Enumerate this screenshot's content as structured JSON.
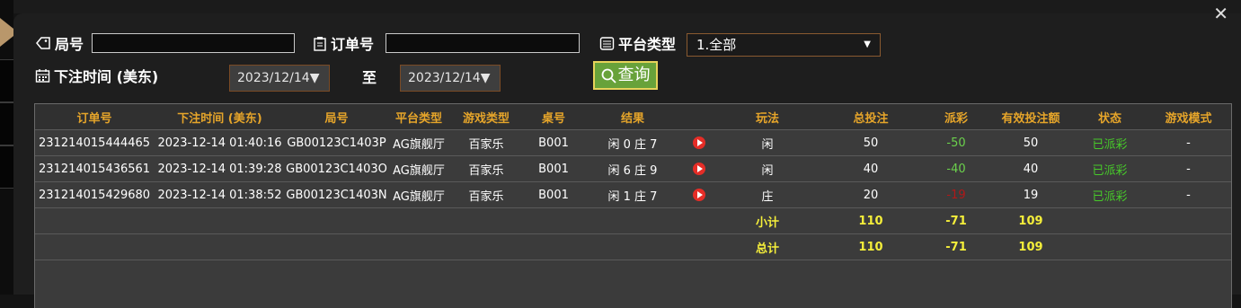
{
  "filters": {
    "round_label": "局号",
    "round_value": "",
    "order_label": "订单号",
    "order_value": "",
    "platform_label": "平台类型",
    "platform_selected": "1.全部",
    "bet_time_label": "下注时间 (美东)",
    "date_from": "2023/12/14",
    "to_label": "至",
    "date_to": "2023/12/14",
    "search_label": "查询"
  },
  "table": {
    "headers": [
      "订单号",
      "下注时间 (美东)",
      "局号",
      "平台类型",
      "游戏类型",
      "桌号",
      "结果",
      "",
      "玩法",
      "总投注",
      "派彩",
      "有效投注额",
      "状态",
      "游戏模式"
    ],
    "rows": [
      {
        "order": "231214015444465",
        "time": "2023-12-14 01:40:16",
        "round": "GB00123C1403P",
        "platform": "AG旗舰厅",
        "game": "百家乐",
        "table": "B001",
        "result": "闲 0 庄 7",
        "play": "闲",
        "bet": "50",
        "payout": "-50",
        "valid": "50",
        "status": "已派彩",
        "mode": "-"
      },
      {
        "order": "231214015436561",
        "time": "2023-12-14 01:39:28",
        "round": "GB00123C1403O",
        "platform": "AG旗舰厅",
        "game": "百家乐",
        "table": "B001",
        "result": "闲 6 庄 9",
        "play": "闲",
        "bet": "40",
        "payout": "-40",
        "valid": "40",
        "status": "已派彩",
        "mode": "-"
      },
      {
        "order": "231214015429680",
        "time": "2023-12-14 01:38:52",
        "round": "GB00123C1403N",
        "platform": "AG旗舰厅",
        "game": "百家乐",
        "table": "B001",
        "result": "闲 1 庄 7",
        "play": "庄",
        "bet": "20",
        "payout": "-19",
        "valid": "19",
        "status": "已派彩",
        "mode": "-"
      }
    ],
    "subtotal": {
      "label": "小计",
      "bet": "110",
      "payout": "-71",
      "valid": "109"
    },
    "total": {
      "label": "总计",
      "bet": "110",
      "payout": "-71",
      "valid": "109"
    }
  },
  "colors": {
    "accent": "#e6a52a",
    "positive_status": "#47c92a",
    "sum": "#f4ee3a",
    "search_button": "#68a23a"
  },
  "icons": {
    "close": "close-icon",
    "tag": "tag-icon",
    "clipboard": "clipboard-icon",
    "list": "list-icon",
    "calendar": "calendar-icon",
    "search": "search-icon",
    "play": "play-icon"
  }
}
